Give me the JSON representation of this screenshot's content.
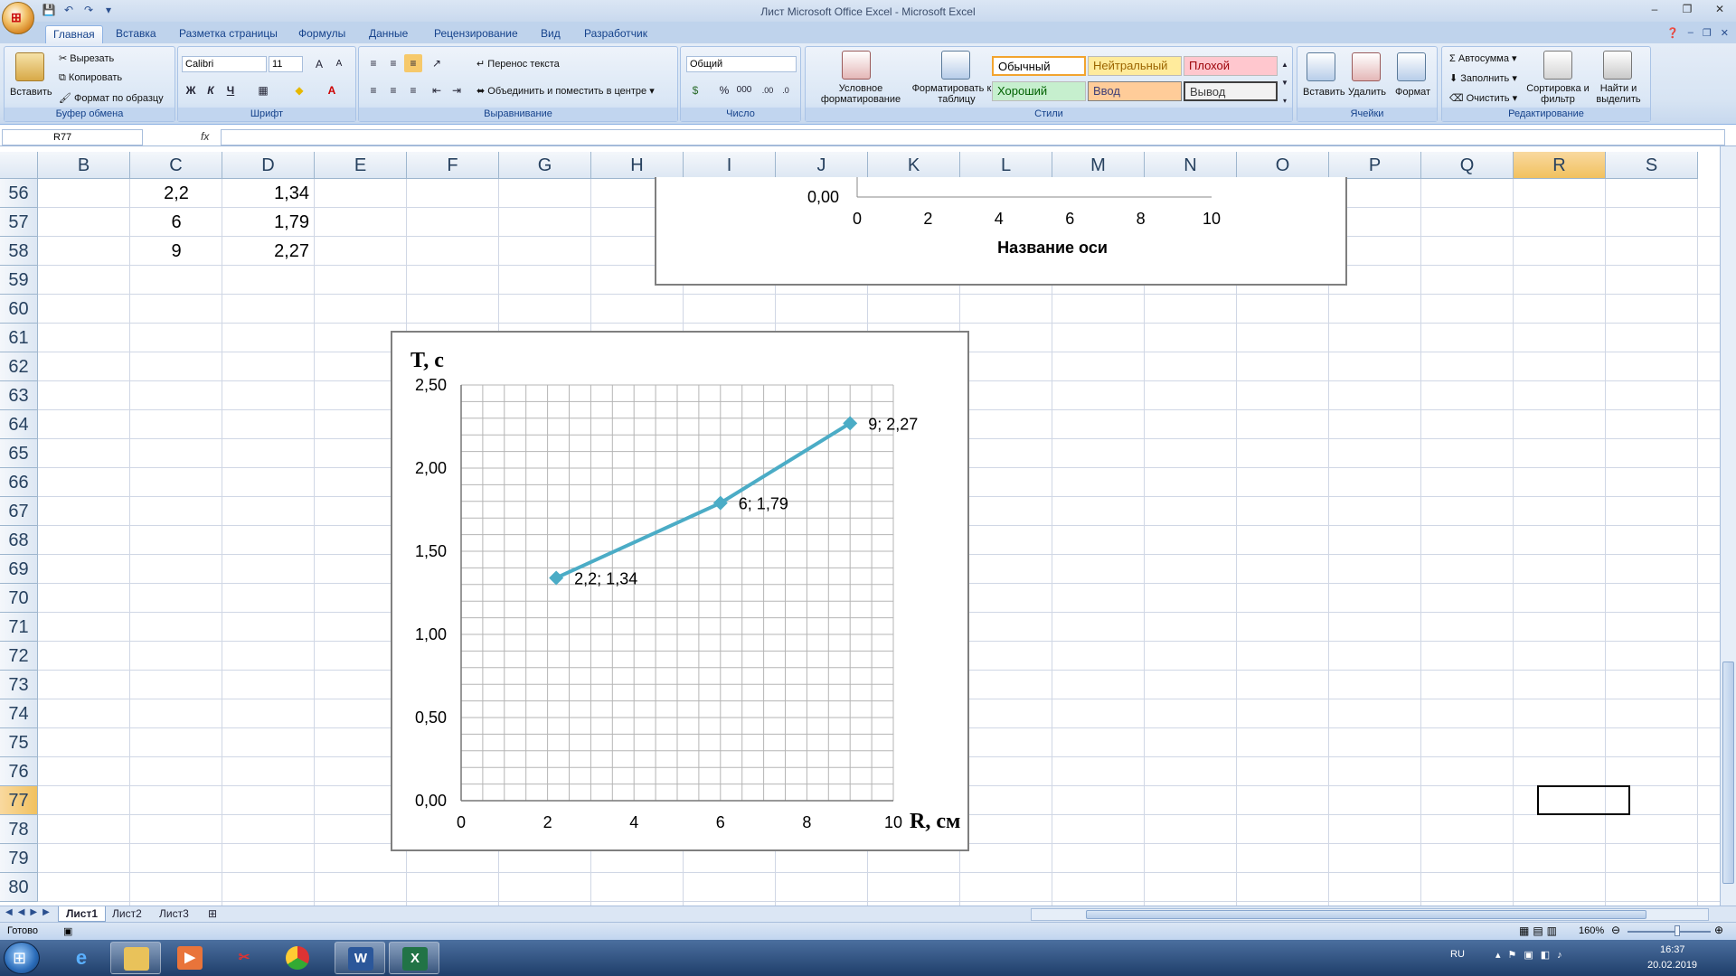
{
  "window": {
    "title": "Лист Microsoft Office Excel - Microsoft Excel",
    "quick_access": [
      "💾",
      "↶",
      "↷",
      "▾"
    ]
  },
  "ribbon_tabs": [
    "Главная",
    "Вставка",
    "Разметка страницы",
    "Формулы",
    "Данные",
    "Рецензирование",
    "Вид",
    "Разработчик"
  ],
  "ribbon": {
    "clipboard": {
      "paste": "Вставить",
      "cut": "Вырезать",
      "copy": "Копировать",
      "format_painter": "Формат по образцу",
      "label": "Буфер обмена"
    },
    "font": {
      "name": "Calibri",
      "size": "11",
      "bold": "Ж",
      "italic": "К",
      "underline": "Ч",
      "label": "Шрифт"
    },
    "alignment": {
      "wrap": "Перенос текста",
      "merge": "Объединить и поместить в центре",
      "label": "Выравнивание"
    },
    "number": {
      "format": "Общий",
      "percent": "%",
      "thousands": "000",
      "label": "Число"
    },
    "styles": {
      "conditional": "Условное форматирование",
      "as_table": "Форматировать как таблицу",
      "normal": "Обычный",
      "neutral": "Нейтральный",
      "bad": "Плохой",
      "good": "Хороший",
      "input": "Ввод",
      "output": "Вывод",
      "label": "Стили"
    },
    "cells": {
      "insert": "Вставить",
      "delete": "Удалить",
      "format": "Формат",
      "label": "Ячейки"
    },
    "editing": {
      "autosum": "Автосумма",
      "fill": "Заполнить",
      "clear": "Очистить",
      "sort": "Сортировка и фильтр",
      "find": "Найти и выделить",
      "label": "Редактирование"
    }
  },
  "formula_bar": {
    "name_box": "R77",
    "fx": "fx",
    "value": ""
  },
  "columns": [
    "B",
    "C",
    "D",
    "E",
    "F",
    "G",
    "H",
    "I",
    "J",
    "K",
    "L",
    "M",
    "N",
    "O",
    "P",
    "Q",
    "R",
    "S"
  ],
  "selected_column": "R",
  "rows": [
    "56",
    "57",
    "58",
    "59",
    "60",
    "61",
    "62",
    "63",
    "64",
    "65",
    "66",
    "67",
    "68",
    "69",
    "70",
    "71",
    "72",
    "73",
    "74",
    "75",
    "76",
    "77",
    "78",
    "79",
    "80"
  ],
  "selected_row": "77",
  "cells": [
    {
      "row": "56",
      "C": "2,2",
      "D": "1,34"
    },
    {
      "row": "57",
      "C": "6",
      "D": "1,79"
    },
    {
      "row": "58",
      "C": "9",
      "D": "2,27"
    }
  ],
  "chart_data": [
    {
      "type": "scatter",
      "partial": true,
      "x_ticks": [
        "0",
        "2",
        "4",
        "6",
        "8",
        "10"
      ],
      "y_ticks_visible": [
        "0,00"
      ],
      "xlabel": "Название оси"
    },
    {
      "type": "line",
      "x": [
        2.2,
        6,
        9
      ],
      "y": [
        1.34,
        1.79,
        2.27
      ],
      "data_labels": [
        "2,2; 1,34",
        "6; 1,79",
        "9; 2,27"
      ],
      "xlabel": "R, см",
      "ylabel": "T, с",
      "xlim": [
        0,
        10
      ],
      "ylim": [
        0,
        2.5
      ],
      "x_ticks": [
        "0",
        "2",
        "4",
        "6",
        "8",
        "10"
      ],
      "y_ticks": [
        "0,00",
        "0,50",
        "1,00",
        "1,50",
        "2,00",
        "2,50"
      ],
      "grid": true,
      "series_color": "#4bacc6"
    }
  ],
  "sheets": [
    "Лист1",
    "Лист2",
    "Лист3"
  ],
  "active_sheet": "Лист1",
  "status": {
    "ready": "Готово",
    "zoom": "160%"
  },
  "taskbar": {
    "lang": "RU",
    "time": "16:37",
    "date": "20.02.2019"
  }
}
